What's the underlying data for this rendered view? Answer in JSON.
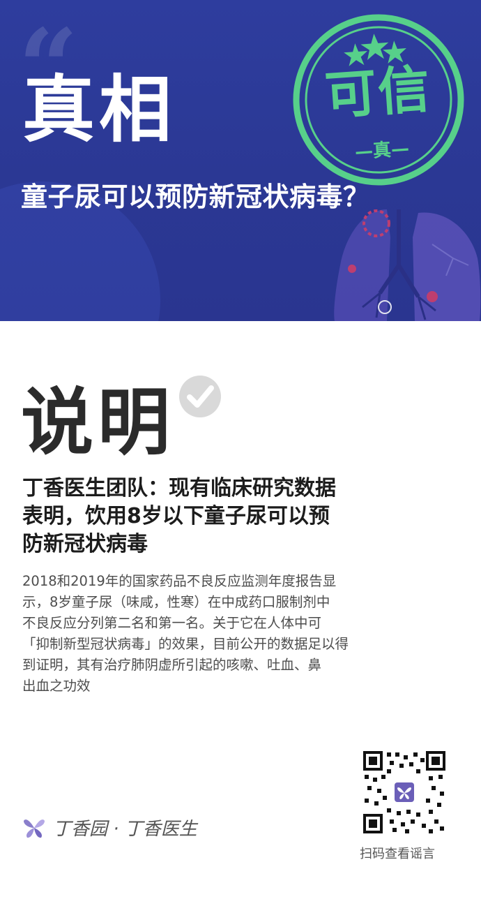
{
  "banner": {
    "title": "真相",
    "question": "童子尿可以预防新冠状病毒？",
    "stamp": {
      "main": "可信",
      "sub": "—真—"
    }
  },
  "section": {
    "title": "说明"
  },
  "headline": {
    "lines": [
      "丁香医生团队：现有临床研究数据",
      "表明，饮用8岁以下童子尿可以预",
      "防新冠状病毒"
    ]
  },
  "body": {
    "lines": [
      "2018和2019年的国家药品不良反应监测年度报告显",
      "示，8岁童子尿（味咸，性寒）在中成药口服制剂中",
      "不良反应分列第二名和第一名。关于它在人体中可",
      "「抑制新型冠状病毒」的效果，目前公开的数据足以得",
      "到证明，其有治疗肺阴虚所引起的咳嗽、吐血、鼻",
      "出血之功效"
    ]
  },
  "footer": {
    "brand": "丁香园 · 丁香医生",
    "qr_caption": "扫码查看谣言"
  },
  "colors": {
    "banner_blue": "#2e3d9e",
    "stamp_green": "#57d08a",
    "title_dark": "#2b2b2b",
    "body_gray": "#4d4d4d"
  }
}
